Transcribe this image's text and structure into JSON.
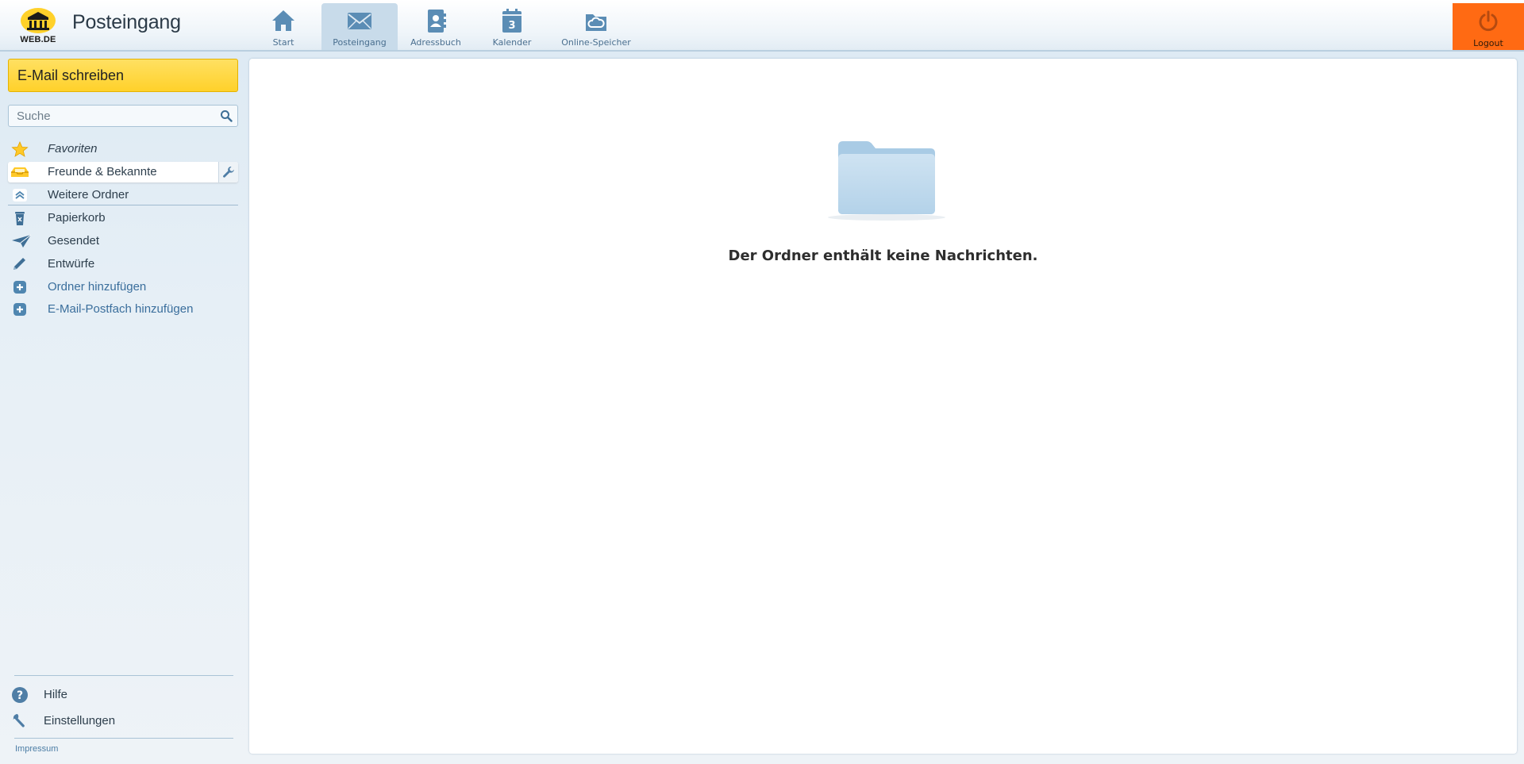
{
  "header": {
    "logo_text": "WEB.DE",
    "title": "Posteingang",
    "nav": [
      {
        "label": "Start",
        "icon": "home-icon",
        "active": false
      },
      {
        "label": "Posteingang",
        "icon": "envelope-icon",
        "active": true
      },
      {
        "label": "Adressbuch",
        "icon": "address-book-icon",
        "active": false
      },
      {
        "label": "Kalender",
        "icon": "calendar-icon",
        "active": false,
        "badge": "3"
      },
      {
        "label": "Online-Speicher",
        "icon": "cloud-icon",
        "active": false
      }
    ],
    "logout_label": "Logout"
  },
  "sidebar": {
    "compose_label": "E-Mail schreiben",
    "search_placeholder": "Suche",
    "folders": [
      {
        "label": "Favoriten",
        "icon": "star-icon"
      },
      {
        "label": "Freunde & Bekannte",
        "icon": "inbox-tray-icon",
        "selected": true
      },
      {
        "label": "Weitere Ordner",
        "icon": "expand-up-icon"
      },
      {
        "label": "Papierkorb",
        "icon": "trash-icon"
      },
      {
        "label": "Gesendet",
        "icon": "paper-plane-icon"
      },
      {
        "label": "Entwürfe",
        "icon": "pencil-icon"
      },
      {
        "label": "Ordner hinzufügen",
        "icon": "plus-icon"
      },
      {
        "label": "E-Mail-Postfach hinzufügen",
        "icon": "plus-icon"
      }
    ],
    "help_label": "Hilfe",
    "settings_label": "Einstellungen",
    "impressum_label": "Impressum"
  },
  "main": {
    "empty_message": "Der Ordner enthält keine Nachrichten."
  },
  "colors": {
    "accent_blue": "#4f86b0",
    "compose_yellow": "#ffd12a",
    "logout_orange": "#ff6a13"
  }
}
